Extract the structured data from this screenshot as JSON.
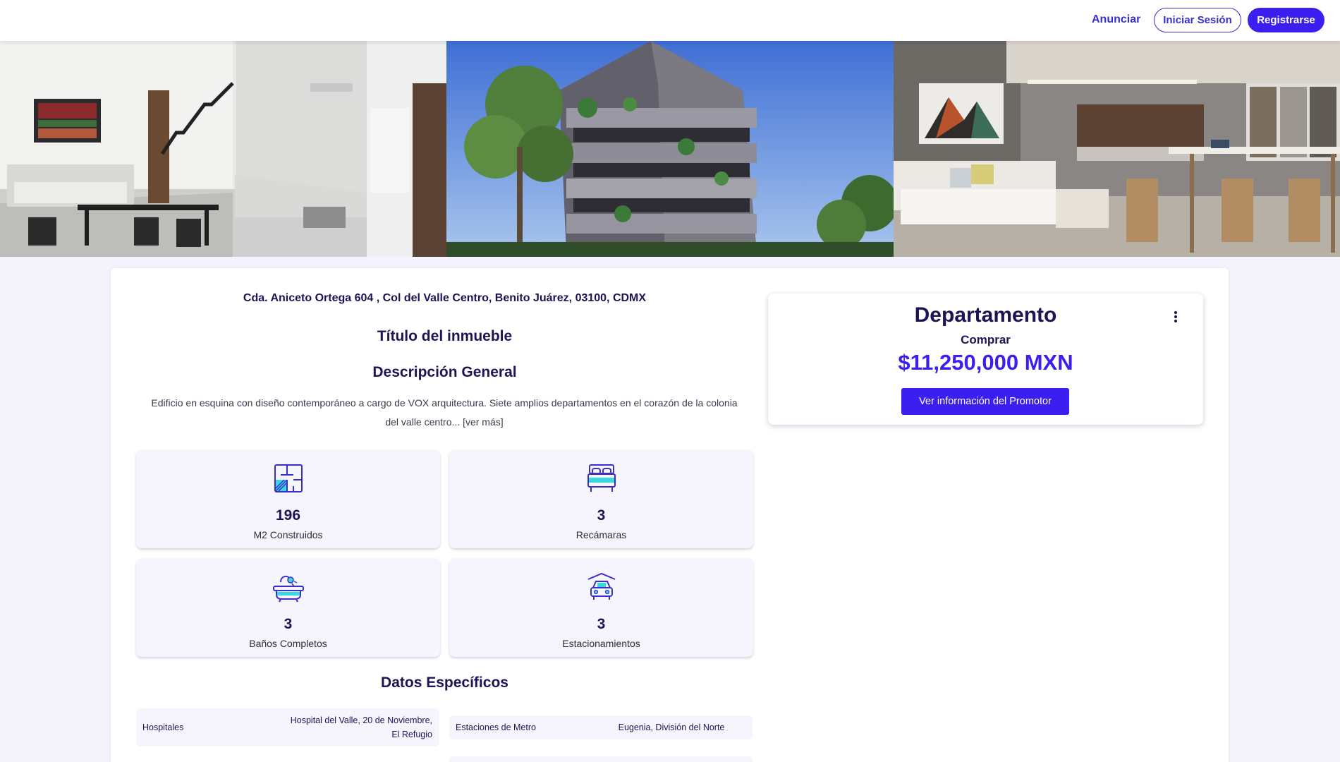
{
  "header": {
    "announce_label": "Anunciar",
    "login_label": "Iniciar Sesión",
    "register_label": "Registrarse"
  },
  "property": {
    "address": "Cda. Aniceto Ortega 604 , Col del Valle Centro, Benito Juárez, 03100, CDMX",
    "title": "Título del inmueble",
    "description_heading": "Descripción General",
    "description": "Edificio en esquina con diseño contemporáneo a cargo de VOX arquitectura. Siete amplios departamentos en el corazón de la colonia del valle centro...",
    "read_more_label": "[ver más]"
  },
  "stats": [
    {
      "icon": "floor-plan-icon",
      "value": "196",
      "label": "M2 Construidos"
    },
    {
      "icon": "bed-icon",
      "value": "3",
      "label": "Recámaras"
    },
    {
      "icon": "bathtub-icon",
      "value": "3",
      "label": "Baños Completos"
    },
    {
      "icon": "garage-car-icon",
      "value": "3",
      "label": "Estacionamientos"
    }
  ],
  "specs": {
    "heading": "Datos Específicos",
    "items": [
      {
        "key": "Hospitales",
        "value": "Hospital del Valle, 20 de Noviembre, El Refugio"
      },
      {
        "key": "Estaciones de Metro",
        "value": "Eugenia, División del Norte"
      }
    ]
  },
  "price_card": {
    "type": "Departamento",
    "operation": "Comprar",
    "price": "$11,250,000 MXN",
    "promoter_button_label": "Ver información del Promotor",
    "menu_icon": "more-vertical-icon"
  },
  "colors": {
    "accent": "#3a1ff0",
    "text_dark": "#1c1454",
    "page_bg": "#f4f3fc",
    "icon_cyan": "#39d7e0"
  }
}
